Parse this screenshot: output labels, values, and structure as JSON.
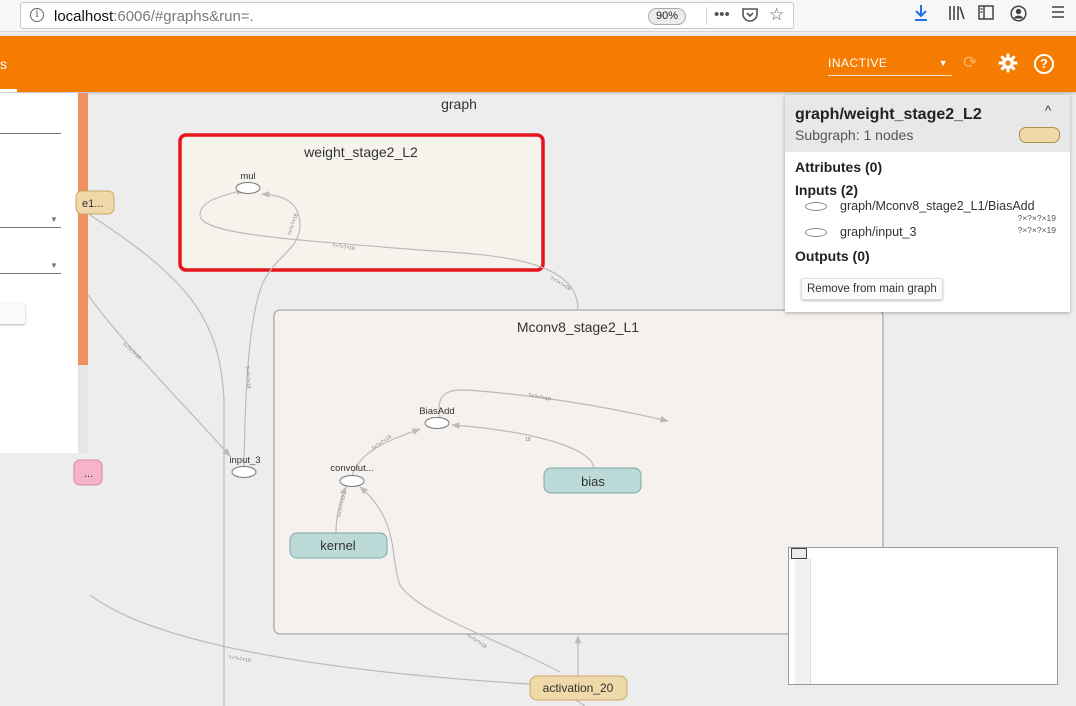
{
  "browser": {
    "url_host": "localhost",
    "url_rest": ":6006/#graphs&run=.",
    "zoom": "90%",
    "info_glyph": "i",
    "menu_icons": [
      "more-icon",
      "pocket-icon",
      "bookmark-star-icon"
    ],
    "toolbar_icons": [
      "download-icon",
      "library-icon",
      "sidebar-icon",
      "account-icon",
      "hamburger-menu-icon"
    ]
  },
  "header": {
    "tab_fragment": "s",
    "run_select_value": "INACTIVE",
    "accent_color": "#f57c00",
    "icons": [
      "reload-icon",
      "gear-icon",
      "help-icon"
    ],
    "help_glyph": "?"
  },
  "graph": {
    "title": "graph",
    "nodes": {
      "weight_stage2_L2": "weight_stage2_L2",
      "mul": "mul",
      "Mconv8_stage2_L1": "Mconv8_stage2_L1",
      "BiasAdd": "BiasAdd",
      "convolut": "convolut...",
      "kernel": "kernel",
      "bias": "bias",
      "input_3": "input_3",
      "activation_20": "activation_20",
      "left_node_1": "e1...",
      "left_node_2": "..."
    },
    "edge_labels": {
      "e1": "?×?×?×19",
      "e2": "?×?×?×19",
      "e3": "?×?×?×19",
      "e4": "?×?×?×19",
      "e5": "?×?×?×19",
      "e6": "?×?×?×19",
      "e7": "19",
      "e8": "?×?×?×19",
      "e9": "?×?×?×19",
      "e10": "?×?×?×19",
      "e11": "?×?×?×19"
    },
    "selected_outline_color": "#e8141b"
  },
  "info_card": {
    "title": "graph/weight_stage2_L2",
    "subtitle": "Subgraph: 1 nodes",
    "collapse_glyph": "^",
    "attributes": "Attributes (0)",
    "inputs": "Inputs (2)",
    "input_items": [
      {
        "name": "graph/Mconv8_stage2_L1/BiasAdd",
        "shape": "?×?×?×19"
      },
      {
        "name": "graph/input_3",
        "shape": "?×?×?×19"
      }
    ],
    "outputs": "Outputs (0)",
    "remove_button": "Remove from main graph"
  }
}
